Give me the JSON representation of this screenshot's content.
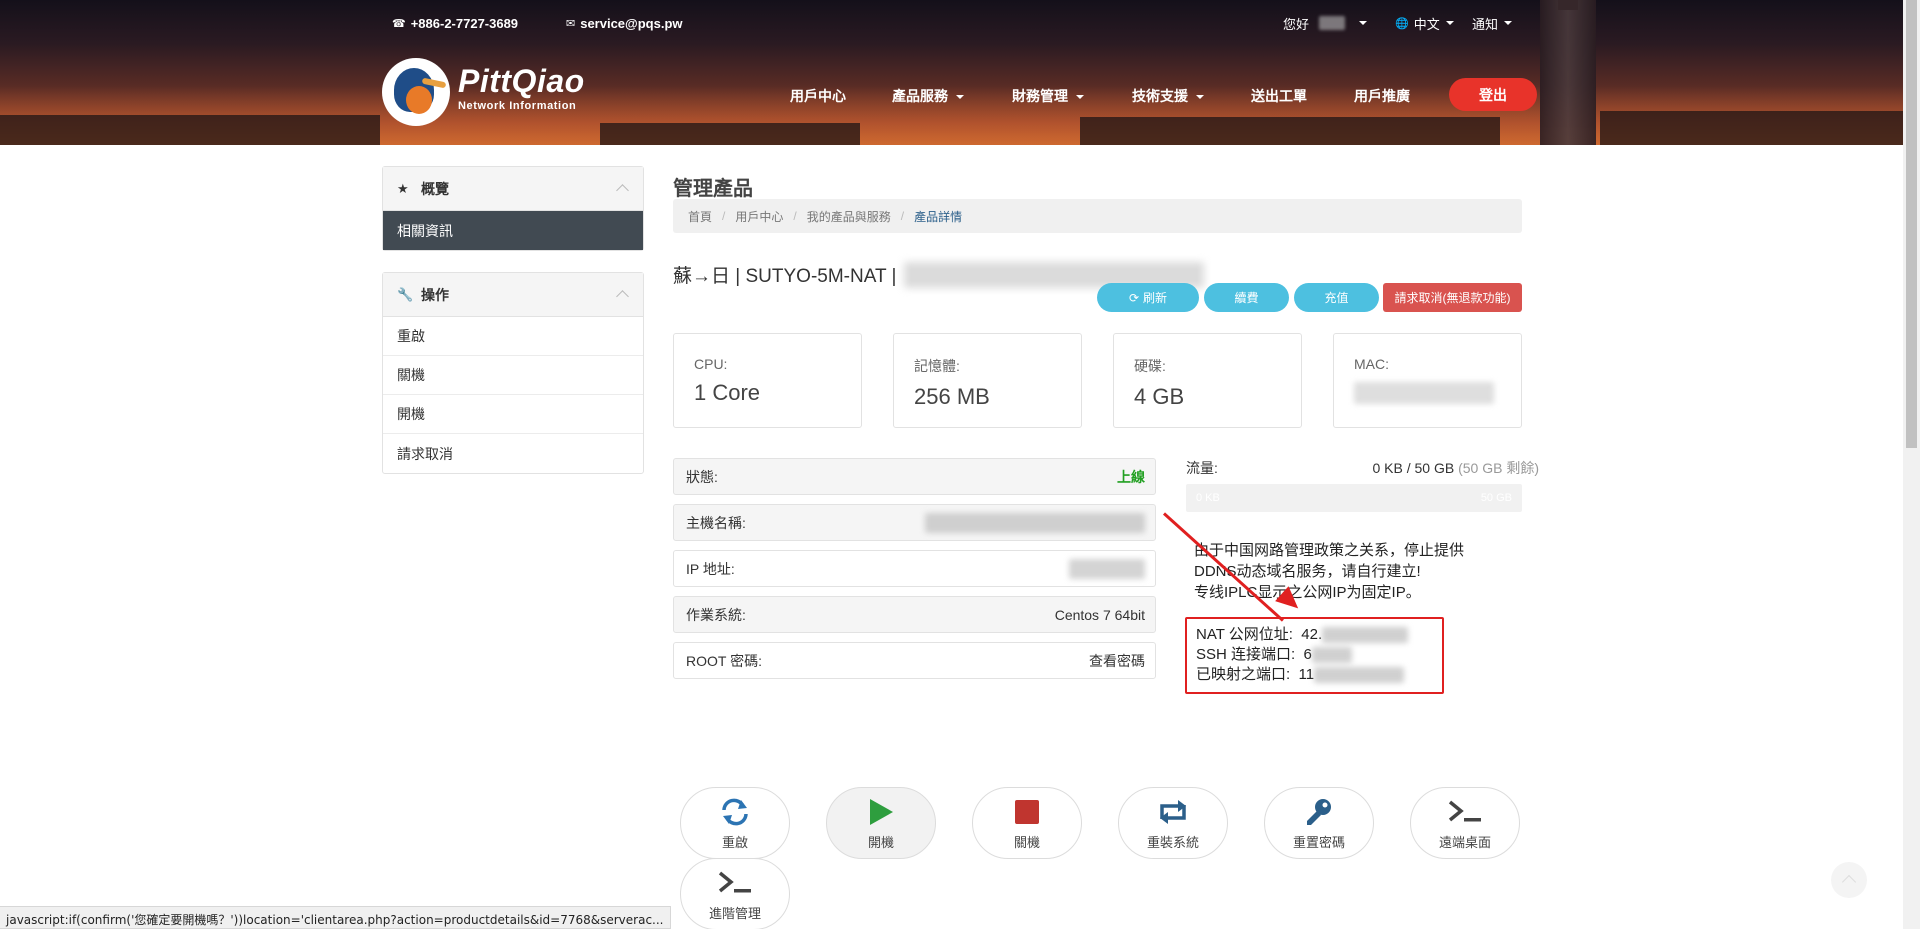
{
  "topbar": {
    "phone": "+886-2-7727-3689",
    "email": "service@pqs.pw",
    "greeting": "您好",
    "language": "中文",
    "notifications": "通知"
  },
  "brand": {
    "name": "PittQiao",
    "tagline": "Network Information"
  },
  "nav": {
    "items": [
      "用戶中心",
      "產品服務",
      "財務管理",
      "技術支援",
      "送出工單",
      "用戶推廣"
    ],
    "logout": "登出"
  },
  "sidebar": {
    "overview": {
      "title": "概覽",
      "items": [
        "相關資訊"
      ]
    },
    "actions": {
      "title": "操作",
      "items": [
        "重啟",
        "關機",
        "開機",
        "請求取消"
      ]
    }
  },
  "page": {
    "title": "管理產品",
    "breadcrumb": [
      "首頁",
      "用戶中心",
      "我的產品與服務",
      "產品詳情"
    ],
    "product_title": "蘇→日 | SUTYO-5M-NAT |"
  },
  "buttons": {
    "refresh": "刷新",
    "renew": "續費",
    "topup": "充值",
    "cancel": "請求取消(無退款功能)"
  },
  "stats": [
    {
      "label": "CPU:",
      "value": "1 Core"
    },
    {
      "label": "記憶體:",
      "value": "256 MB"
    },
    {
      "label": "硬碟:",
      "value": "4 GB"
    },
    {
      "label": "MAC:",
      "value": ""
    }
  ],
  "info": {
    "status_label": "狀態:",
    "status_value": "上線",
    "hostname_label": "主機名稱:",
    "ip_label": "IP 地址:",
    "os_label": "作業系統:",
    "os_value": "Centos 7 64bit",
    "root_label": "ROOT 密碼:",
    "root_action": "查看密碼"
  },
  "traffic": {
    "label": "流量:",
    "used": "0 KB / 50 GB",
    "remaining": "(50 GB 剩餘)",
    "bar_left": "0 KB",
    "bar_right": "50 GB",
    "used_fraction": 0
  },
  "notice": {
    "line1": "由于中国网路管理政策之关系，停止提供",
    "line2": "DDNS动态域名服务，请自行建立!",
    "line3": "专线IPLC显示之公网IP为固定IP。"
  },
  "nat": {
    "ip_label": "NAT 公网位址:",
    "ip_prefix": "42.",
    "ssh_label": "SSH 连接端口:",
    "ssh_prefix": "6",
    "ports_label": "已映射之端口:",
    "ports_prefix": "11"
  },
  "actions": [
    "重啟",
    "開機",
    "關機",
    "重裝系統",
    "重置密碼",
    "遠端桌面",
    "進階管理"
  ],
  "statusbar": "javascript:if(confirm('您確定要開機嗎？'))location='clientarea.php?action=productdetails&id=7768&serverac...",
  "colors": {
    "accent": "#4dc0e0",
    "danger": "#d9534f",
    "logout": "#e8332a",
    "online": "#22a022",
    "highlight": "#e02020",
    "sidebar_active": "#414a52"
  }
}
